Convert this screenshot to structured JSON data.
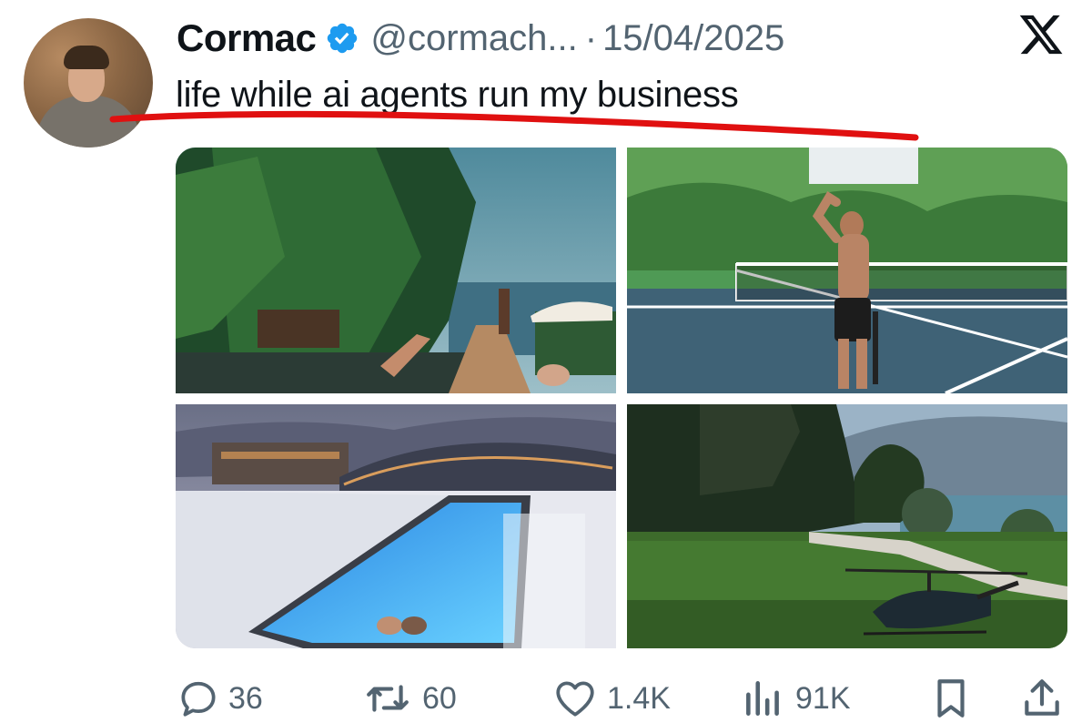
{
  "tweet": {
    "author_name": "Cormac",
    "handle": "@cormach...",
    "separator": "·",
    "date": "15/04/2025",
    "text": "life while ai agents run my business",
    "verified": true
  },
  "media": {
    "images": [
      "resort-pool-dive",
      "tennis-court-drinking",
      "rooftop-infinity-pool-snow",
      "estate-lawn-helicopter"
    ]
  },
  "actions": {
    "replies": "36",
    "reposts": "60",
    "likes": "1.4K",
    "views": "91K"
  },
  "icons": [
    "reply-icon",
    "repost-icon",
    "like-icon",
    "views-icon",
    "bookmark-icon",
    "share-icon",
    "x-logo-icon",
    "verified-badge-icon"
  ],
  "colors": {
    "verified_blue": "#1d9bf0",
    "secondary_text": "#536471",
    "annotation_red": "#e01010"
  }
}
